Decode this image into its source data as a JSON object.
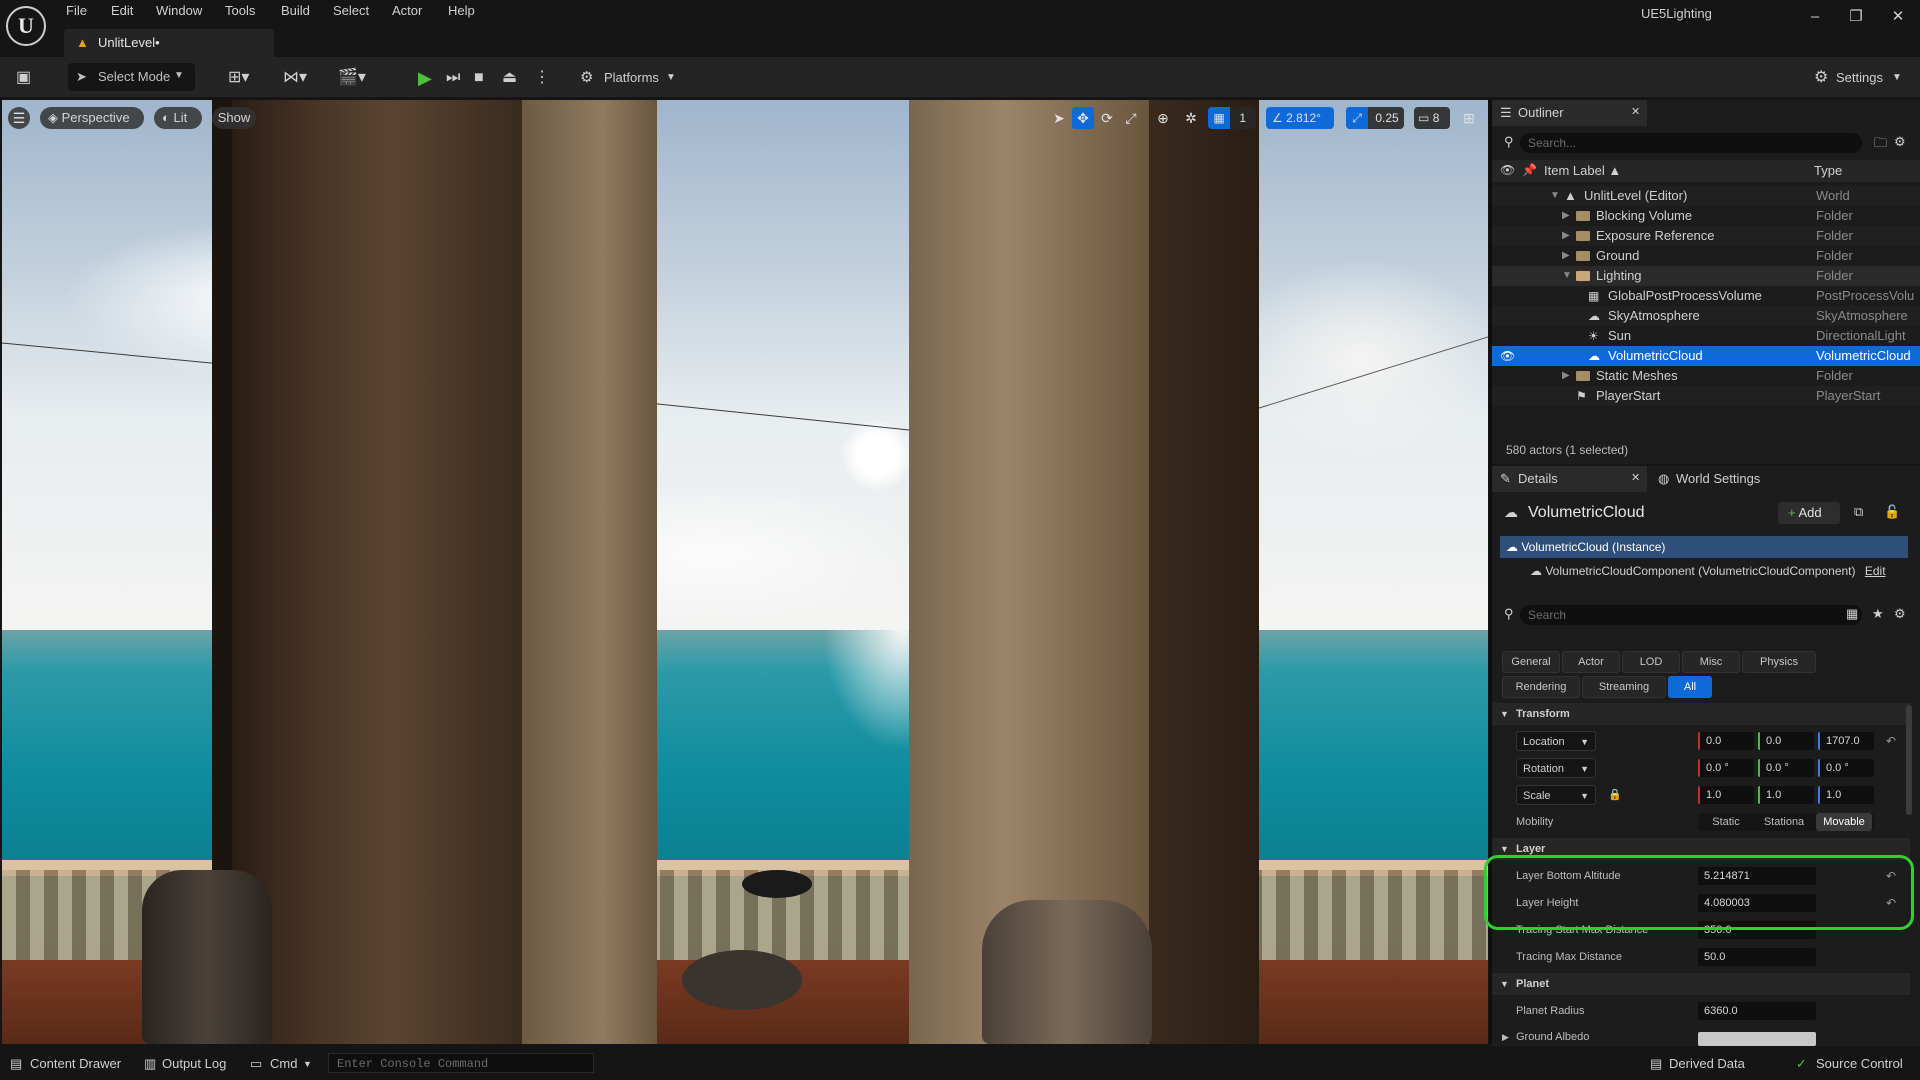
{
  "app": {
    "logo": "U",
    "project_name": "UE5Lighting",
    "menu": [
      "File",
      "Edit",
      "Window",
      "Tools",
      "Build",
      "Select",
      "Actor",
      "Help"
    ],
    "window_controls": {
      "minimize": "–",
      "restore": "❐",
      "close": "✕"
    },
    "level_tab": {
      "icon": "level-icon",
      "label": "UnlitLevel•"
    }
  },
  "toolbar": {
    "save_icon": "save-icon",
    "select_mode": "Select Mode",
    "platforms": "Platforms",
    "settings": "Settings"
  },
  "viewport": {
    "menu_icon": "☰",
    "perspective": "Perspective",
    "lit": "Lit",
    "show": "Show",
    "angle_snap": "2.812°",
    "scale_snap": "0.25",
    "grid_snap": "1",
    "camera_speed": "8"
  },
  "outliner": {
    "tab": "Outliner",
    "search_placeholder": "Search...",
    "col_label": "Item Label ▲",
    "col_type": "Type",
    "rows": [
      {
        "label": "UnlitLevel (Editor)",
        "type": "World"
      },
      {
        "label": "Blocking Volume",
        "type": "Folder"
      },
      {
        "label": "Exposure Reference",
        "type": "Folder"
      },
      {
        "label": "Ground",
        "type": "Folder"
      },
      {
        "label": "Lighting",
        "type": "Folder"
      },
      {
        "label": "GlobalPostProcessVolume",
        "type": "PostProcessVolu"
      },
      {
        "label": "SkyAtmosphere",
        "type": "SkyAtmosphere"
      },
      {
        "label": "Sun",
        "type": "DirectionalLight"
      },
      {
        "label": "VolumetricCloud",
        "type": "VolumetricCloud"
      },
      {
        "label": "Static Meshes",
        "type": "Folder"
      },
      {
        "label": "PlayerStart",
        "type": "PlayerStart"
      }
    ],
    "actor_count": "580 actors (1 selected)"
  },
  "details": {
    "tab": "Details",
    "world_settings_tab": "World Settings",
    "actor_name": "VolumetricCloud",
    "add_button": "Add",
    "instance": "VolumetricCloud (Instance)",
    "component": "VolumetricCloudComponent (VolumetricCloudComponent)",
    "component_edit": "Edit",
    "search_placeholder": "Search",
    "filters": [
      "General",
      "Actor",
      "LOD",
      "Misc",
      "Physics",
      "Rendering",
      "Streaming",
      "All"
    ],
    "active_filter": "All",
    "transform": {
      "section": "Transform",
      "location_label": "Location",
      "location": [
        "0.0",
        "0.0",
        "1707.0"
      ],
      "rotation_label": "Rotation",
      "rotation": [
        "0.0 °",
        "0.0 °",
        "0.0 °"
      ],
      "scale_label": "Scale",
      "scale": [
        "1.0",
        "1.0",
        "1.0"
      ],
      "mobility_label": "Mobility",
      "mobility_options": [
        "Static",
        "Stationa",
        "Movable"
      ],
      "mobility_selected": "Movable"
    },
    "layer": {
      "section": "Layer",
      "bottom_altitude_label": "Layer Bottom Altitude",
      "bottom_altitude": "5.214871",
      "height_label": "Layer Height",
      "height": "4.080003",
      "tracing_start_label": "Tracing Start Max Distance",
      "tracing_start": "350.0",
      "tracing_max_label": "Tracing Max Distance",
      "tracing_max": "50.0"
    },
    "planet": {
      "section": "Planet",
      "radius_label": "Planet Radius",
      "radius": "6360.0",
      "ground_albedo_label": "Ground Albedo"
    }
  },
  "statusbar": {
    "content_drawer": "Content Drawer",
    "output_log": "Output Log",
    "cmd": "Cmd",
    "console_placeholder": "Enter Console Command",
    "derived_data": "Derived Data",
    "source_control": "Source Control"
  },
  "colors": {
    "accent": "#0e6ad8",
    "highlight": "#2fd12f",
    "play": "#4fc03a"
  }
}
